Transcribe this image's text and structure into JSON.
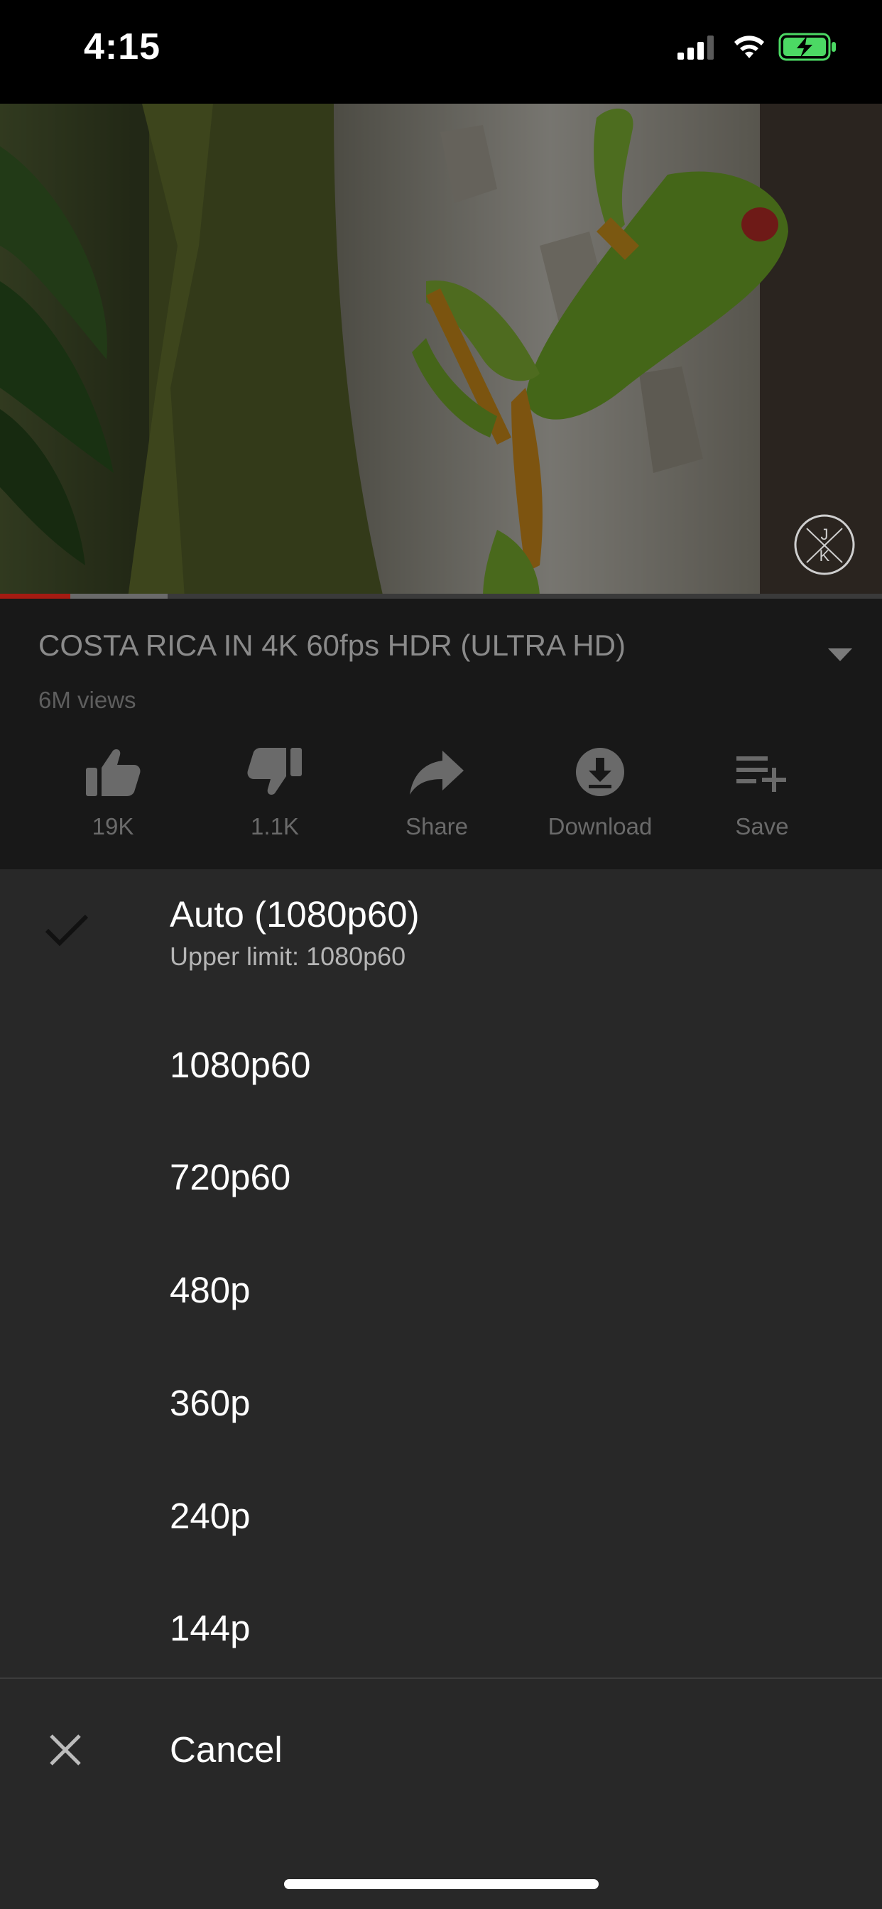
{
  "status_bar": {
    "time": "4:15"
  },
  "player": {
    "watermark_letters": "J K",
    "played_fraction": 0.08,
    "buffered_fraction": 0.19
  },
  "video": {
    "title": "COSTA RICA IN 4K 60fps HDR (ULTRA HD)",
    "views": "6M views",
    "actions": {
      "like": {
        "label": "19K",
        "icon": "thumbs-up-icon"
      },
      "dislike": {
        "label": "1.1K",
        "icon": "thumbs-down-icon"
      },
      "share": {
        "label": "Share",
        "icon": "share-arrow-icon"
      },
      "download": {
        "label": "Download",
        "icon": "download-icon"
      },
      "save": {
        "label": "Save",
        "icon": "playlist-add-icon"
      }
    }
  },
  "quality_menu": {
    "selected": "Auto (1080p60)",
    "options": [
      {
        "label": "Auto (1080p60)",
        "sublabel": "Upper limit: 1080p60",
        "checked": true
      },
      {
        "label": "1080p60"
      },
      {
        "label": "720p60"
      },
      {
        "label": "480p"
      },
      {
        "label": "360p"
      },
      {
        "label": "240p"
      },
      {
        "label": "144p"
      }
    ],
    "cancel_label": "Cancel"
  },
  "colors": {
    "sheet_background": "#282828",
    "progress_played": "#a51b12",
    "battery_charging": "#4cd964"
  }
}
